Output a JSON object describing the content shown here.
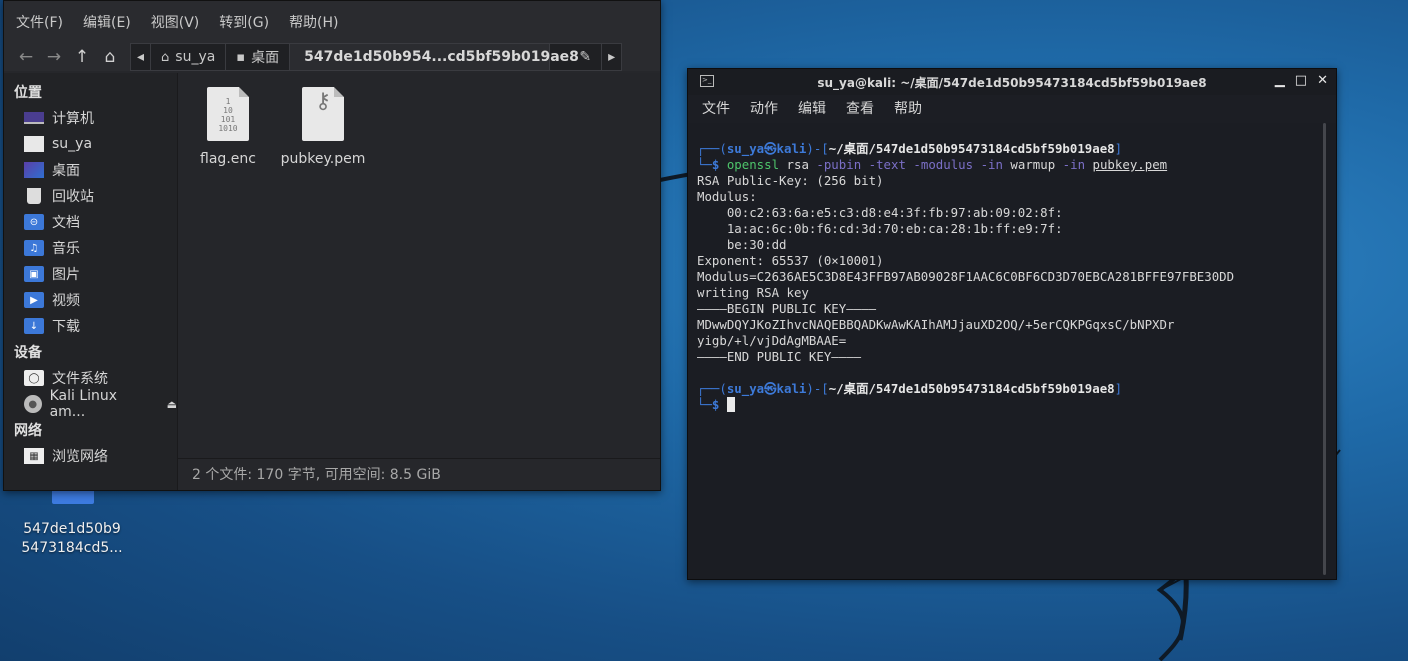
{
  "desktop": {
    "folder_label_line1": "547de1d50b9",
    "folder_label_line2": "5473184cd5..."
  },
  "file_manager": {
    "menu": [
      "文件(F)",
      "编辑(E)",
      "视图(V)",
      "转到(G)",
      "帮助(H)"
    ],
    "breadcrumbs": {
      "home": "su_ya",
      "desktop": "桌面",
      "current": "547de1d50b954...cd5bf59b019ae8"
    },
    "sidebar": {
      "places_header": "位置",
      "places": [
        "计算机",
        "su_ya",
        "桌面",
        "回收站",
        "文档",
        "音乐",
        "图片",
        "视频",
        "下载"
      ],
      "devices_header": "设备",
      "devices": [
        "文件系统",
        "Kali Linux am..."
      ],
      "network_header": "网络",
      "network": [
        "浏览网络"
      ]
    },
    "files": [
      {
        "name": "flag.enc",
        "icon": "binary-file-icon"
      },
      {
        "name": "pubkey.pem",
        "icon": "key-file-icon"
      }
    ],
    "status": "2 个文件: 170 字节, 可用空间: 8.5 GiB"
  },
  "terminal": {
    "title": "su_ya@kali: ~/桌面/547de1d50b95473184cd5bf59b019ae8",
    "menu": [
      "文件",
      "动作",
      "编辑",
      "查看",
      "帮助"
    ],
    "prompt_user": "su_ya㉿kali",
    "prompt_path": "~/桌面/547de1d50b95473184cd5bf59b019ae8",
    "command": {
      "cmd": "openssl",
      "sub": "rsa",
      "opts": [
        "-pubin",
        "-text",
        "-modulus",
        "-in"
      ],
      "in1": "warmup",
      "opt_in2": "-in",
      "in2": "pubkey.pem"
    },
    "output": [
      "RSA Public-Key: (256 bit)",
      "Modulus:",
      "    00:c2:63:6a:e5:c3:d8:e4:3f:fb:97:ab:09:02:8f:",
      "    1a:ac:6c:0b:f6:cd:3d:70:eb:ca:28:1b:ff:e9:7f:",
      "    be:30:dd",
      "Exponent: 65537 (0×10001)",
      "Modulus=C2636AE5C3D8E43FFB97AB09028F1AAC6C0BF6CD3D70EBCA281BFFE97FBE30DD",
      "writing RSA key",
      "————BEGIN PUBLIC KEY————",
      "MDwwDQYJKoZIhvcNAQEBBQADKwAwKAIhAMJjauXD2OQ/+5erCQKPGqxsC/bNPXDr",
      "yigb/+l/vjDdAgMBAAE=",
      "————END PUBLIC KEY————"
    ]
  }
}
